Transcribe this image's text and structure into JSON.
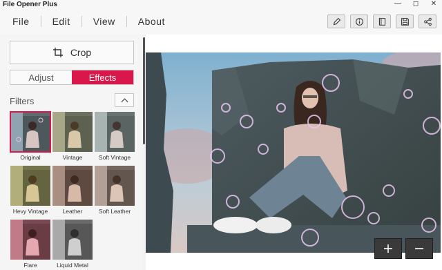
{
  "app": {
    "title": "File Opener Plus"
  },
  "window_controls": {
    "minimize": "—",
    "maximize": "◻",
    "close": "✕"
  },
  "menu": {
    "items": [
      "File",
      "Edit",
      "View",
      "About"
    ]
  },
  "toolbar": {
    "icons": [
      "pencil-icon",
      "info-icon",
      "panel-icon",
      "save-icon",
      "share-icon"
    ]
  },
  "sidebar": {
    "crop_label": "Crop",
    "tabs": [
      {
        "label": "Adjust",
        "active": false
      },
      {
        "label": "Effects",
        "active": true
      }
    ],
    "filters_label": "Filters",
    "filters": [
      {
        "label": "Original",
        "selected": true
      },
      {
        "label": "Vintage",
        "selected": false
      },
      {
        "label": "Soft Vintage",
        "selected": false
      },
      {
        "label": "Hevy Vintage",
        "selected": false
      },
      {
        "label": "Leather",
        "selected": false
      },
      {
        "label": "Soft Leather",
        "selected": false
      },
      {
        "label": "Flare",
        "selected": false
      },
      {
        "label": "Liquid Metal",
        "selected": false
      }
    ]
  },
  "zoom": {
    "in_icon": "plus-icon",
    "out_icon": "minus-icon"
  },
  "colors": {
    "accent": "#d8174a",
    "zoom_button": "#3a3a3a",
    "panel": "#f5f5f5"
  }
}
